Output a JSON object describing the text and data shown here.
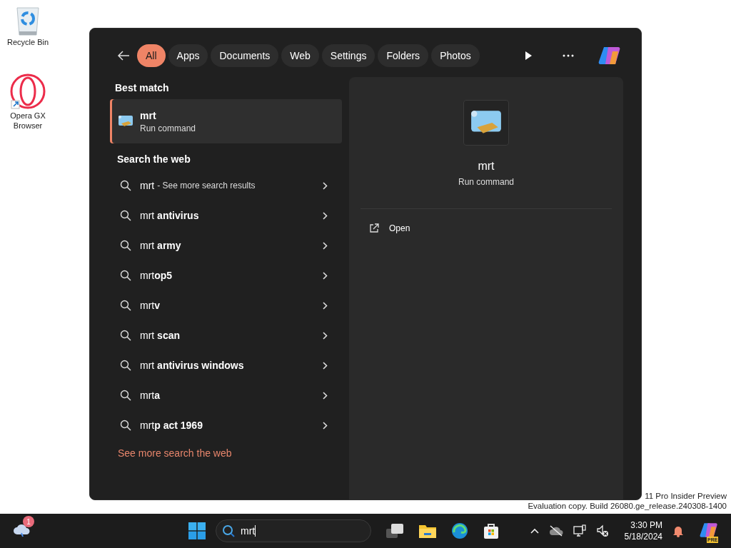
{
  "desktop": {
    "icons": [
      {
        "label": "Recycle Bin",
        "kind": "recycle"
      },
      {
        "label": "Opera GX Browser",
        "kind": "opera"
      }
    ],
    "watermark": [
      "11 Pro Insider Preview",
      "Evaluation copy. Build 26080.ge_release.240308-1400"
    ]
  },
  "search_panel": {
    "filters": [
      {
        "label": "All",
        "selected": true
      },
      {
        "label": "Apps",
        "selected": false
      },
      {
        "label": "Documents",
        "selected": false
      },
      {
        "label": "Web",
        "selected": false
      },
      {
        "label": "Settings",
        "selected": false
      },
      {
        "label": "Folders",
        "selected": false
      },
      {
        "label": "Photos",
        "selected": false
      }
    ],
    "best_match": {
      "heading": "Best match",
      "name": "mrt",
      "type": "Run command",
      "selected": true
    },
    "web": {
      "heading": "Search the web",
      "items": [
        {
          "kind": "more",
          "query": "mrt",
          "note": "- See more search results"
        },
        {
          "kind": "suggestion",
          "text": "mrt **antivirus**"
        },
        {
          "kind": "suggestion",
          "text": "mrt **army**"
        },
        {
          "kind": "suggestion",
          "text": "mrt**op5**"
        },
        {
          "kind": "suggestion",
          "text": "mrt**v**"
        },
        {
          "kind": "suggestion",
          "text": "mrt **scan**"
        },
        {
          "kind": "suggestion",
          "text": "mrt **antivirus windows**"
        },
        {
          "kind": "suggestion",
          "text": "mrt**a**"
        },
        {
          "kind": "suggestion",
          "text": "mrt**p act 1969**"
        }
      ],
      "see_more": "See more search the web"
    },
    "preview": {
      "name": "mrt",
      "type": "Run command",
      "actions": [
        "Open"
      ]
    }
  },
  "taskbar": {
    "weather_badge": "1",
    "search": {
      "value": "mrt"
    },
    "clock": {
      "time": "3:30 PM",
      "date": "5/18/2024"
    },
    "copilot_badge": "PRE"
  }
}
